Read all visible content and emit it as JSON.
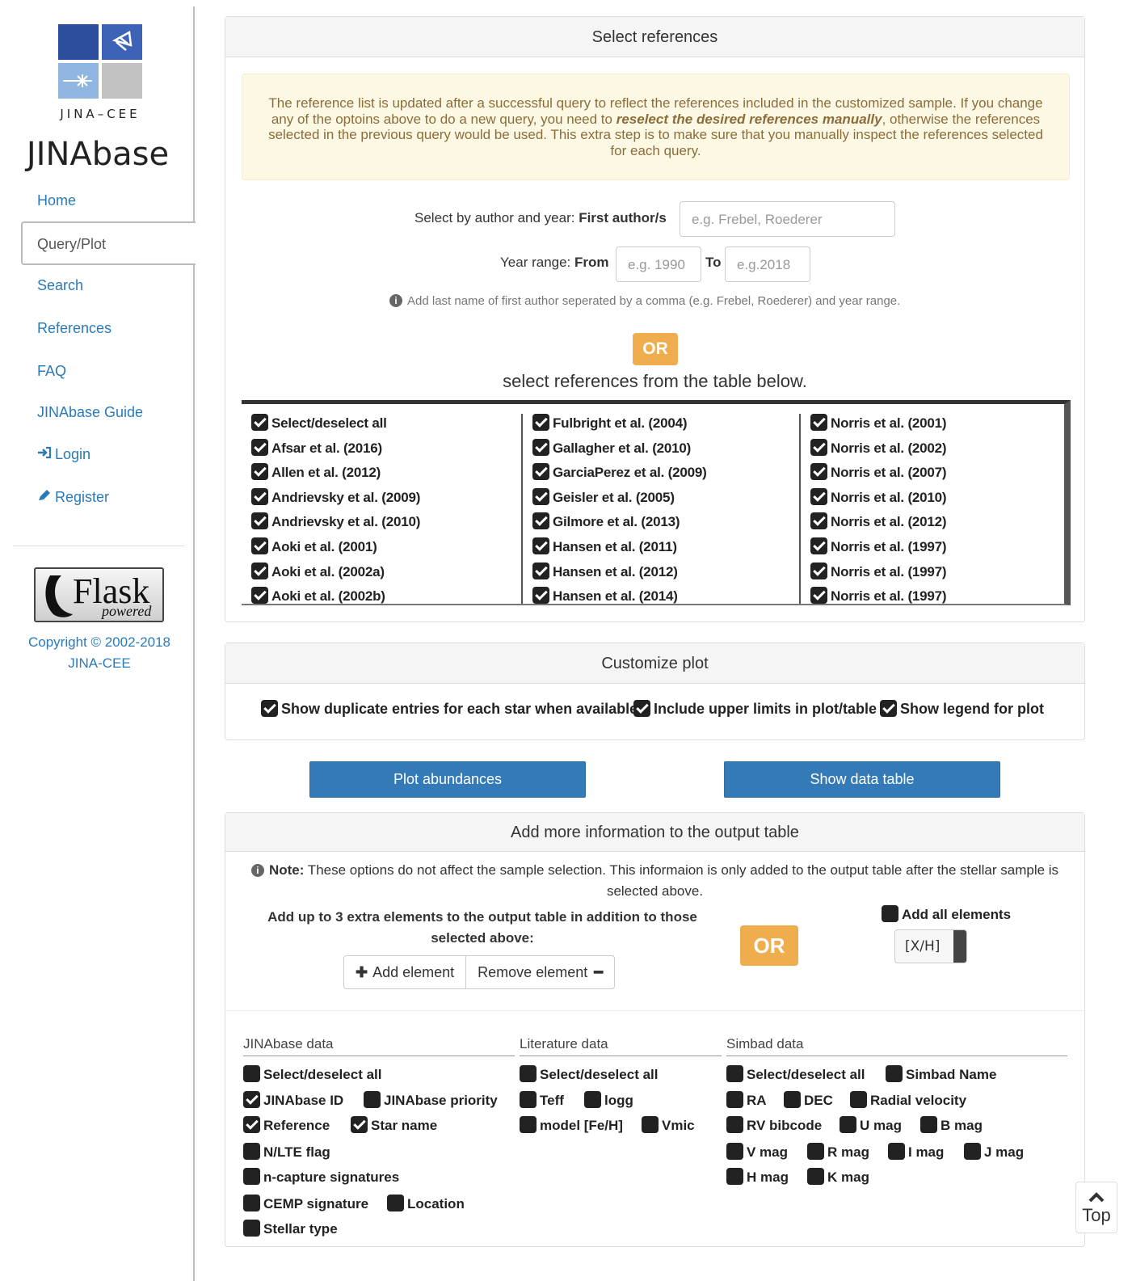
{
  "sidebar": {
    "logo_text": "JINA–CEE",
    "brand": "JINAbase",
    "nav": {
      "home": "Home",
      "query": "Query/Plot",
      "search": "Search",
      "references": "References",
      "faq": "FAQ",
      "guide": "JINAbase Guide",
      "login": "Login",
      "register": "Register"
    },
    "flask": {
      "word": "Flask",
      "sub": "powered"
    },
    "copyright_line1": "Copyright © 2002-2018",
    "copyright_line2": "JINA-CEE"
  },
  "select_refs": {
    "title": "Select references",
    "alert_a": "The reference list is updated after a successful query to reflect the references included in the customized sample. If you change any of the optoins above to do a new query, you need to ",
    "alert_b": "reselect the desired references manually",
    "alert_c": ", otherwise the references selected in the previous query would be used. This extra step is to make sure that you manually inspect the references selected for each query.",
    "author_label": "Select by author and year: ",
    "author_label_bold": "First author/s",
    "author_placeholder": "e.g. Frebel, Roederer",
    "year_label": "Year range: ",
    "from_label": "From",
    "from_placeholder": "e.g. 1990",
    "to_label": "To",
    "to_placeholder": "e.g.2018",
    "hint": "Add last name of first author seperated by a comma (e.g. Frebel, Roederer) and year range.",
    "or": "OR",
    "table_heading": "select references from the table below.",
    "col1": [
      "Select/deselect all",
      "Afsar et al. (2016)",
      "Allen et al. (2012)",
      "Andrievsky et al. (2009)",
      "Andrievsky et al. (2010)",
      "Aoki et al. (2001)",
      "Aoki et al. (2002a)",
      "Aoki et al. (2002b)"
    ],
    "col2": [
      "Fulbright et al. (2004)",
      "Gallagher et al. (2010)",
      "GarciaPerez et al. (2009)",
      "Geisler et al. (2005)",
      "Gilmore et al. (2013)",
      "Hansen et al. (2011)",
      "Hansen et al. (2012)",
      "Hansen et al. (2014)"
    ],
    "col3": [
      "Norris et al. (2001)",
      "Norris et al. (2002)",
      "Norris et al. (2007)",
      "Norris et al. (2010)",
      "Norris et al. (2012)",
      "Norris et al. (1997)",
      "Norris et al. (1997)",
      "Norris et al. (1997)"
    ]
  },
  "customize": {
    "title": "Customize plot",
    "opt1": "Show duplicate entries for each star when available",
    "opt2": "Include upper limits in plot/table",
    "opt3": "Show legend for plot"
  },
  "actions": {
    "plot": "Plot abundances",
    "table": "Show data table"
  },
  "more_info": {
    "title": "Add more information to the output table",
    "note_bold": "Note:",
    "note_text": " These options do not affect the sample selection. This informaion is only added to the output table after the stellar sample is selected above.",
    "extra_label": "Add up to 3 extra elements to the output table in addition to those selected above:",
    "add_element": "Add element",
    "remove_element": "Remove element",
    "or": "OR",
    "add_all": "Add all elements",
    "select_value": "[X/H]",
    "groups": {
      "jinabase": "JINAbase data",
      "literature": "Literature data",
      "simbad": "Simbad data"
    },
    "jinabase_items": {
      "sel_all": "Select/deselect all",
      "id": "JINAbase ID",
      "priority": "JINAbase priority",
      "reference": "Reference",
      "star_name": "Star name",
      "nlte": "N/LTE flag",
      "ncap": "n-capture signatures",
      "cemp": "CEMP signature",
      "location": "Location",
      "stellar_type": "Stellar type"
    },
    "literature_items": {
      "sel_all": "Select/deselect all",
      "teff": "Teff",
      "logg": "logg",
      "model": "model [Fe/H]",
      "vmic": "Vmic"
    },
    "simbad_items": {
      "sel_all": "Select/deselect all",
      "name": "Simbad Name",
      "ra": "RA",
      "dec": "DEC",
      "rv": "Radial velocity",
      "rv_bib": "RV bibcode",
      "u": "U mag",
      "b": "B mag",
      "v": "V mag",
      "r": "R mag",
      "i": "I mag",
      "j": "J mag",
      "h": "H mag",
      "k": "K mag"
    }
  },
  "top_button": "Top"
}
